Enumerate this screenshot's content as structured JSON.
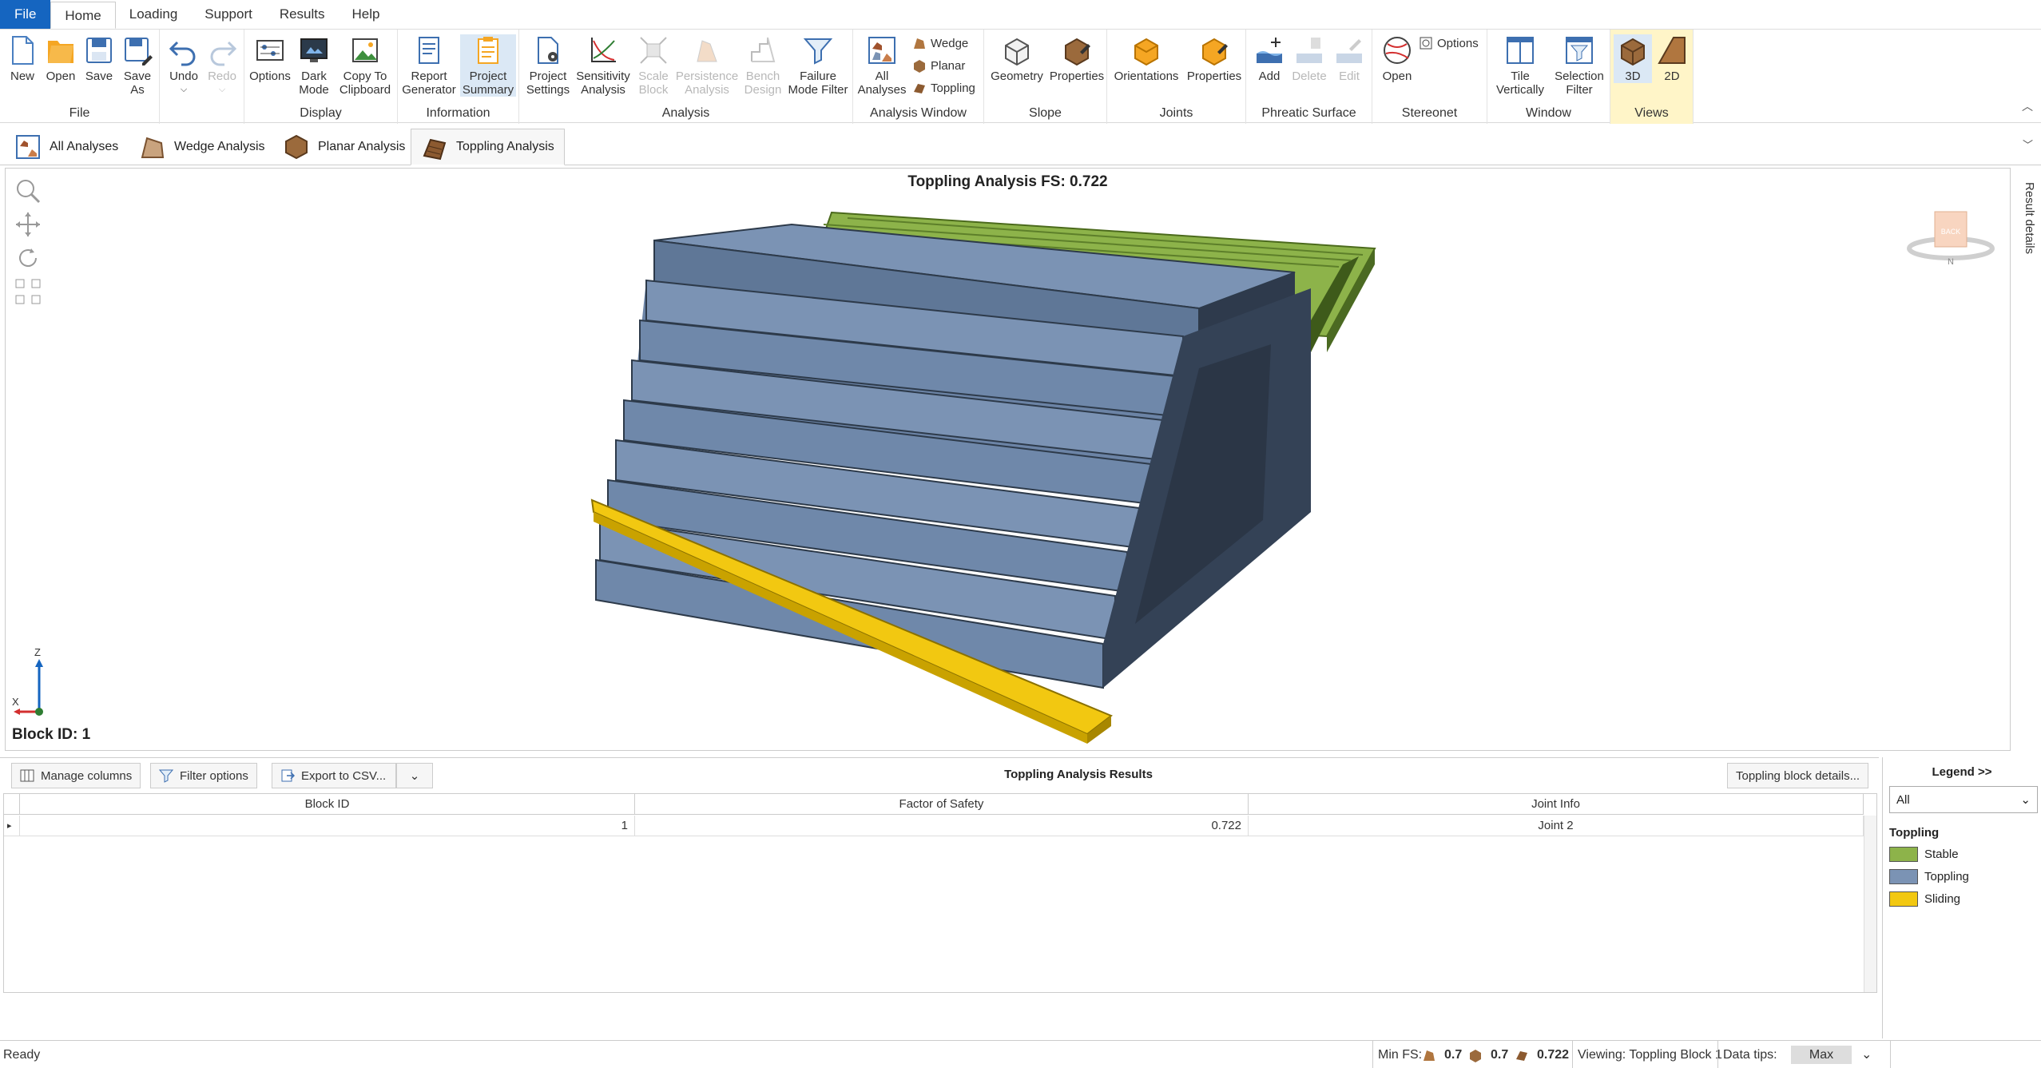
{
  "menu": {
    "tabs": [
      "File",
      "Home",
      "Loading",
      "Support",
      "Results",
      "Help"
    ]
  },
  "ribbon": {
    "file": {
      "label": "File",
      "new": "New",
      "open": "Open",
      "save": "Save",
      "save_as": "Save As"
    },
    "edit": {
      "undo": "Undo",
      "redo": "Redo"
    },
    "display": {
      "label": "Display",
      "options": "Options",
      "dark_mode": "Dark Mode",
      "copy": "Copy To Clipboard"
    },
    "information": {
      "label": "Information",
      "report": "Report Generator",
      "summary": "Project Summary"
    },
    "analysis": {
      "label": "Analysis",
      "settings": "Project Settings",
      "sensitivity": "Sensitivity Analysis",
      "scale_block": "Scale Block",
      "persistence": "Persistence Analysis",
      "bench": "Bench Design",
      "failure_filter": "Failure Mode Filter"
    },
    "analysis_window": {
      "label": "Analysis Window",
      "all": "All Analyses",
      "wedge": "Wedge",
      "planar": "Planar",
      "toppling": "Toppling"
    },
    "slope": {
      "label": "Slope",
      "geometry": "Geometry",
      "properties": "Properties"
    },
    "joints": {
      "label": "Joints",
      "orientations": "Orientations",
      "properties": "Properties"
    },
    "phreatic": {
      "label": "Phreatic Surface",
      "add": "Add",
      "delete": "Delete",
      "edit": "Edit"
    },
    "stereonet": {
      "label": "Stereonet",
      "open": "Open",
      "options": "Options"
    },
    "window": {
      "label": "Window",
      "tile": "Tile Vertically",
      "selection": "Selection Filter"
    },
    "views": {
      "label": "Views",
      "v3d": "3D",
      "v2d": "2D"
    }
  },
  "doc_tabs": [
    "All Analyses",
    "Wedge Analysis",
    "Planar Analysis",
    "Toppling Analysis"
  ],
  "viewport": {
    "title": "Toppling Analysis FS: 0.722",
    "block_id": "Block ID: 1",
    "axis_x": "X",
    "axis_z": "Z",
    "cube_label": "BACK",
    "compass_n": "N",
    "side_panel": "Result details"
  },
  "table": {
    "manage_columns": "Manage columns",
    "filter_options": "Filter options",
    "export": "Export to CSV...",
    "title": "Toppling Analysis Results",
    "details_button": "Toppling block details...",
    "columns": [
      "Block ID",
      "Factor of Safety",
      "Joint Info"
    ],
    "rows": [
      {
        "block_id": "1",
        "fs": "0.722",
        "joint": "Joint 2"
      }
    ]
  },
  "legend": {
    "header": "Legend >>",
    "filter": "All",
    "section": "Toppling",
    "items": [
      {
        "label": "Stable",
        "color": "#8db34a"
      },
      {
        "label": "Toppling",
        "color": "#7b93b4"
      },
      {
        "label": "Sliding",
        "color": "#f2c811"
      }
    ]
  },
  "status": {
    "ready": "Ready",
    "min_fs_label": "Min FS:",
    "fs_wedge": "0.7",
    "fs_planar": "0.7",
    "fs_toppling": "0.722",
    "viewing": "Viewing: Toppling Block 1",
    "data_tips": "Data tips:",
    "max": "Max"
  },
  "colors": {
    "accent": "#1565c0",
    "stable": "#8db34a",
    "toppling": "#7b93b4",
    "sliding": "#f2c811"
  }
}
